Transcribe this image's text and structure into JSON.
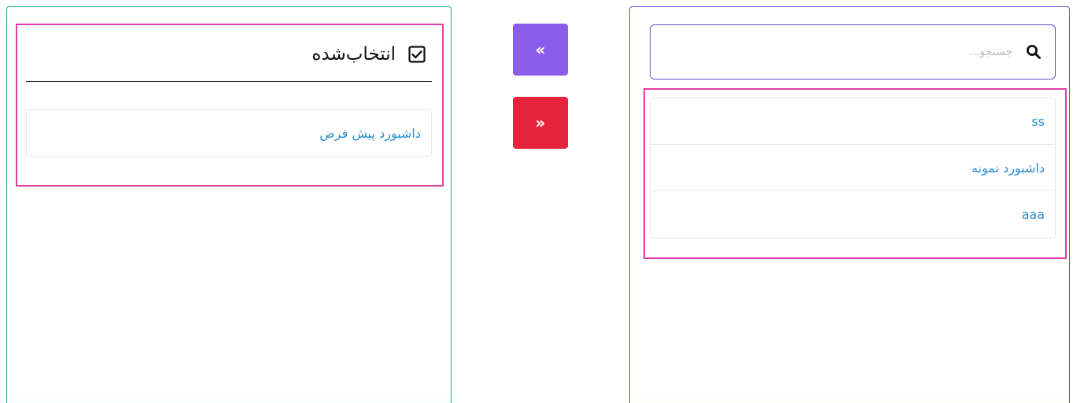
{
  "selected_panel": {
    "title": "انتخاب‌شده",
    "items": [
      {
        "label": "داشبورد پیش فرض"
      }
    ]
  },
  "buttons": {
    "move_all_left_label": "«",
    "move_all_right_label": "»"
  },
  "available_panel": {
    "search": {
      "placeholder": "جستجو...",
      "value": ""
    },
    "items": [
      {
        "label": "ss"
      },
      {
        "label": "داشبورد نمونه"
      },
      {
        "label": "aaa"
      }
    ]
  },
  "colors": {
    "left_panel_border": "#2aa79b",
    "right_panel_border": "#6b4fd1",
    "highlight": "#e23ea6",
    "button_purple": "#8c5cec",
    "button_red": "#e5243b",
    "item_text": "#2e8fd0"
  },
  "icons": {
    "header_check": "checkbox-checked-icon",
    "search": "search-icon",
    "move_all_left": "double-chevron-left-icon",
    "move_all_right": "double-chevron-right-icon"
  }
}
